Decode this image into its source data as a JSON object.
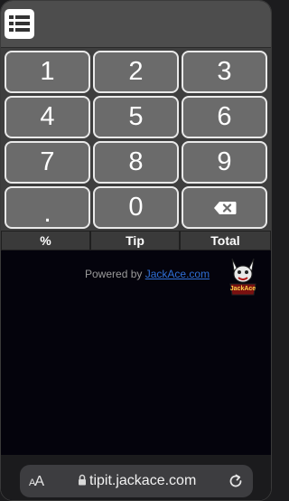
{
  "keypad": {
    "keys": [
      "1",
      "2",
      "3",
      "4",
      "5",
      "6",
      "7",
      "8",
      "9",
      ".",
      "0"
    ],
    "backspace_icon": "backspace-icon"
  },
  "modes": [
    "%",
    "Tip",
    "Total"
  ],
  "footer": {
    "powered_by": "Powered by",
    "link_text": "JackAce.com",
    "logo_text": "JackAce"
  },
  "browser": {
    "text_size_label_small": "A",
    "text_size_label_large": "A",
    "url": "tipit.jackace.com"
  },
  "colors": {
    "page_background": "#04030c",
    "key_fill": "#6b6b6b",
    "key_border": "#e9e9e9",
    "link": "#2f6fd6"
  }
}
